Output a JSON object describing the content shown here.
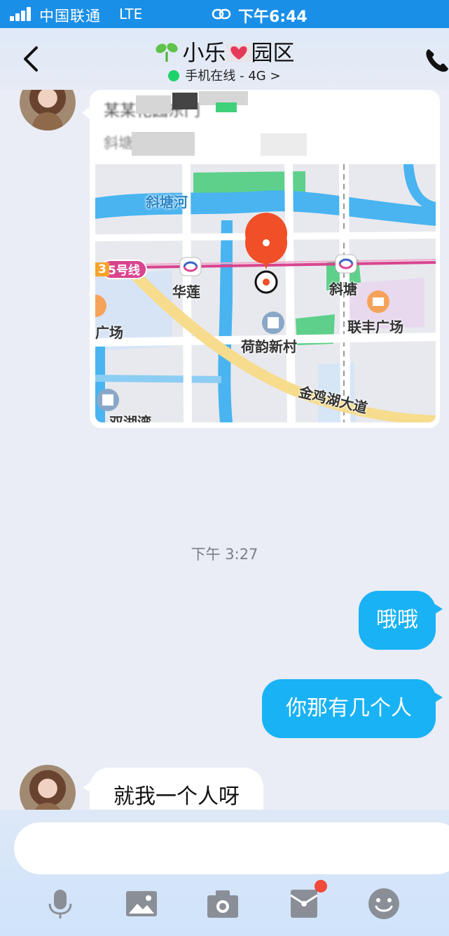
{
  "status_bar": {
    "carrier": "中国联通",
    "network": "LTE",
    "time": "下午6:44"
  },
  "header": {
    "title_part1": "小乐",
    "title_part2": "园区",
    "status": "手机在线 - 4G >"
  },
  "location_card": {
    "place_name": "某某花园东门",
    "address": "斜塘花园",
    "map_labels": {
      "river": "斜塘河",
      "metro_line": "5号线",
      "metro_line_prefix": "3",
      "station_1": "华莲",
      "station_2": "斜塘",
      "mall": "联丰广场",
      "plaza_left": "广场",
      "village": "荷韵新村",
      "road": "金鸡湖大道",
      "bottom_left": "双湖湾"
    }
  },
  "messages": {
    "timestamp": "下午 3:27",
    "sent_1": "哦哦",
    "sent_2": "你那有几个人",
    "received_1": "就我一个人呀"
  },
  "colors": {
    "status_bar": "#1a8fe8",
    "sent_bubble": "#19b2f5",
    "online_dot": "#1ed26a",
    "map_pin": "#f04f27",
    "metro_line": "#d9448f"
  },
  "toolbar_icons": [
    "microphone-icon",
    "image-icon",
    "camera-icon",
    "red-packet-icon",
    "emoji-icon"
  ]
}
